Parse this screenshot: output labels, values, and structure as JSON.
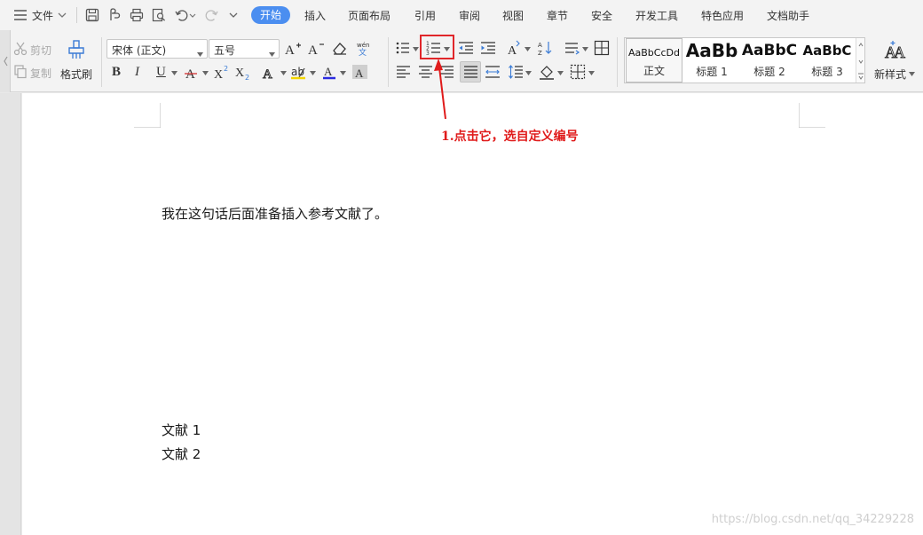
{
  "menubar": {
    "file_label": "文件",
    "tabs": [
      "开始",
      "插入",
      "页面布局",
      "引用",
      "审阅",
      "视图",
      "章节",
      "安全",
      "开发工具",
      "特色应用",
      "文档助手"
    ],
    "active_tab": "开始"
  },
  "ribbon": {
    "clipboard": {
      "cut": "剪切",
      "copy": "复制",
      "format_painter": "格式刷"
    },
    "font": {
      "name": "宋体 (正文)",
      "size": "五号"
    },
    "styles": [
      {
        "sample": "AaBbCcDd",
        "name": "正文"
      },
      {
        "sample": "AaBb",
        "name": "标题 1"
      },
      {
        "sample": "AaBbC",
        "name": "标题 2"
      },
      {
        "sample": "AaBbC",
        "name": "标题 3"
      }
    ],
    "new_style": "新样式"
  },
  "document": {
    "sentence": "我在这句话后面准备插入参考文献了。",
    "refs": [
      "文献 1",
      "文献 2"
    ]
  },
  "annotation": {
    "text": "1.点击它，选自定义编号",
    "color": "#e01b1b"
  },
  "watermark": "https://blog.csdn.net/qq_34229228",
  "colors": {
    "accent": "#4b8ef0",
    "annotation_red": "#e01b1b"
  },
  "icons": [
    "menu-icon",
    "save-icon",
    "print-icon",
    "undo-icon",
    "redo-icon",
    "numbering-icon",
    "bullets-icon"
  ]
}
